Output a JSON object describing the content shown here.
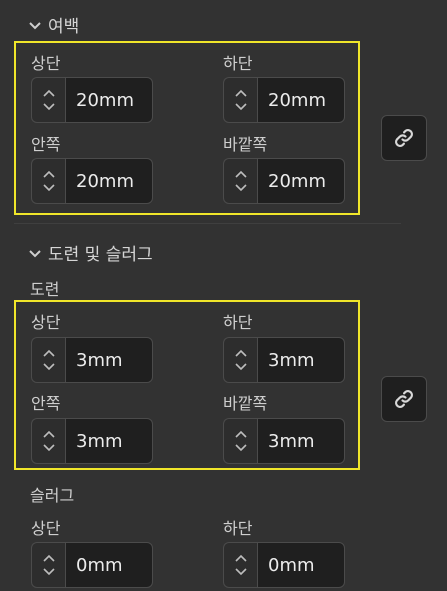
{
  "margins": {
    "title": "여백",
    "fields": [
      {
        "label": "상단",
        "value": "20mm"
      },
      {
        "label": "하단",
        "value": "20mm"
      },
      {
        "label": "안쪽",
        "value": "20mm"
      },
      {
        "label": "바깥쪽",
        "value": "20mm"
      }
    ]
  },
  "bleed_slug": {
    "title": "도련 및 슬러그",
    "bleed": {
      "title": "도련",
      "fields": [
        {
          "label": "상단",
          "value": "3mm"
        },
        {
          "label": "하단",
          "value": "3mm"
        },
        {
          "label": "안쪽",
          "value": "3mm"
        },
        {
          "label": "바깥쪽",
          "value": "3mm"
        }
      ]
    },
    "slug": {
      "title": "슬러그",
      "fields": [
        {
          "label": "상단",
          "value": "0mm"
        },
        {
          "label": "하단",
          "value": "0mm"
        }
      ]
    }
  },
  "icons": {
    "collapse": "chevron-down-icon",
    "link": "link-icon",
    "step_up": "chevron-up-icon",
    "step_down": "chevron-down-icon"
  },
  "colors": {
    "background": "#323232",
    "highlight": "#f0e62a",
    "field_bg": "#1f1f1f",
    "text": "#d4d4d4"
  }
}
